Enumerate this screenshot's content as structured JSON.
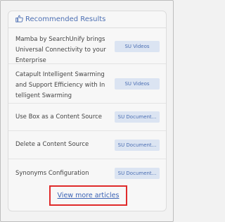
{
  "widget": {
    "title": "Recommended Results",
    "icon": "thumbs-up-icon",
    "accent_color": "#4c6fb3",
    "highlight_color": "#e02b2b"
  },
  "results": [
    {
      "title": "Mamba by SearchUnify brings Universal Connectivity to your Enterprise",
      "source": "SU Videos"
    },
    {
      "title": "Catapult Intelligent Swarming and Support Efficiency with In telligent Swarming",
      "source": "SU Videos"
    },
    {
      "title": "Use Box as a Content Source",
      "source": "SU Document..."
    },
    {
      "title": "Delete a Content Source",
      "source": "SU Document..."
    },
    {
      "title": "Synonyms Configuration",
      "source": "SU Document..."
    }
  ],
  "footer": {
    "more_label": "View more articles"
  }
}
